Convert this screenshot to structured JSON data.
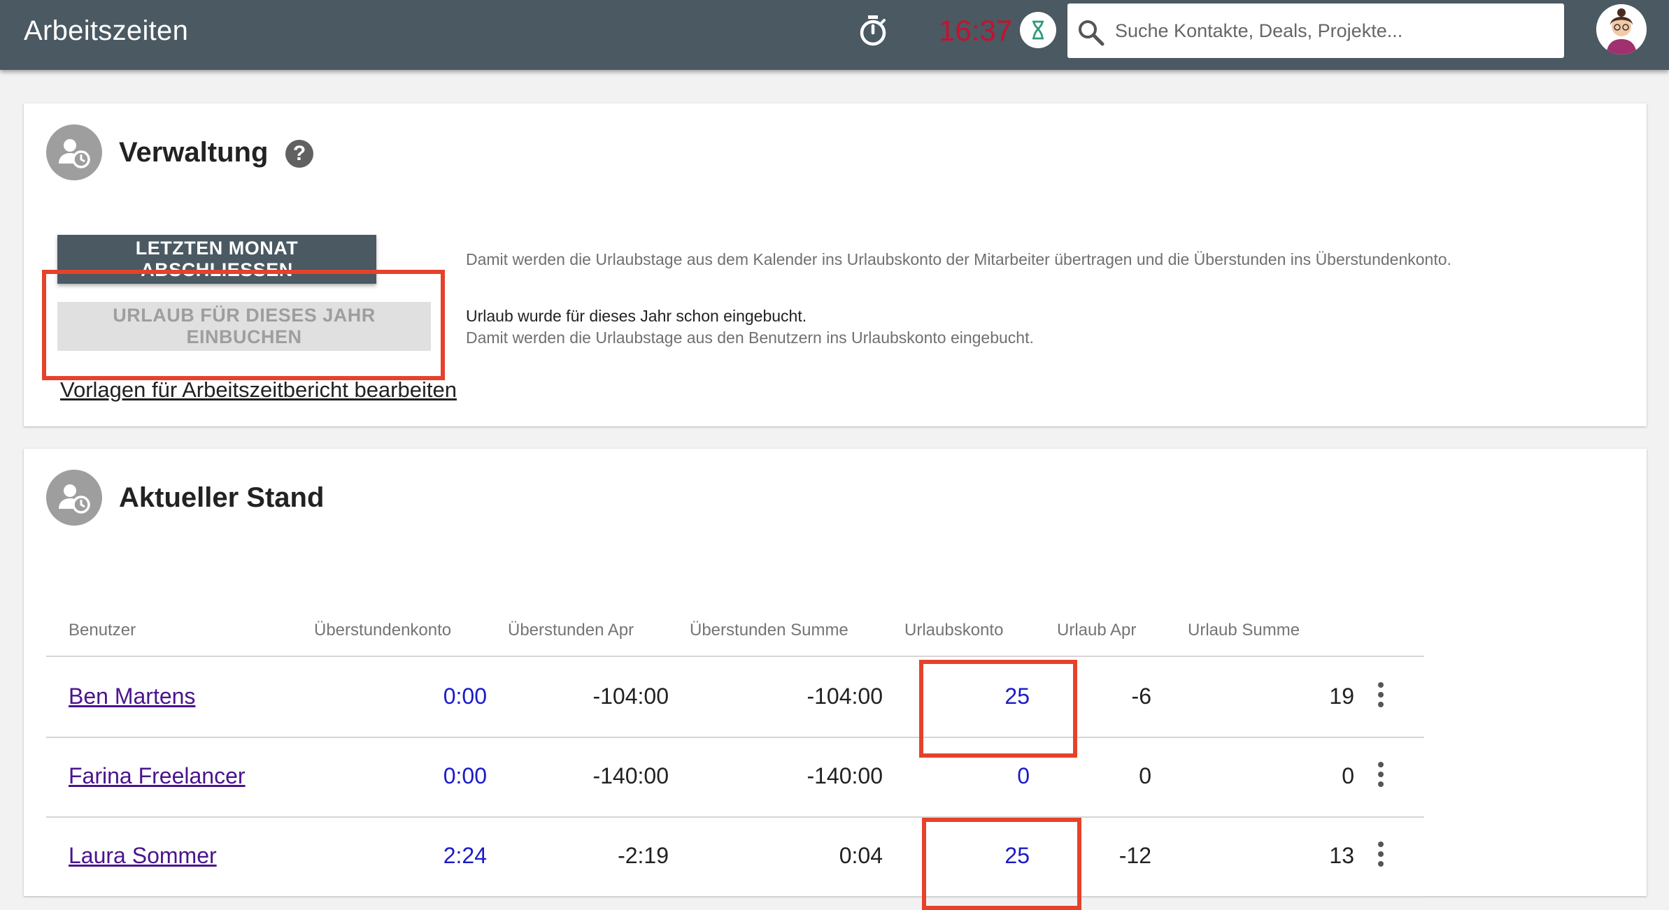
{
  "header": {
    "title": "Arbeitszeiten",
    "clock": "16:37",
    "search_placeholder": "Suche Kontakte, Deals, Projekte..."
  },
  "admin": {
    "title": "Verwaltung",
    "close_month_label": "LETZTEN MONAT ABSCHLIESSEN",
    "close_month_desc": "Damit werden die Urlaubstage aus dem Kalender ins Urlaubskonto der Mitarbeiter übertragen und die Überstunden ins Überstundenkonto.",
    "book_leave_label": "URLAUB FÜR DIESES JAHR EINBUCHEN",
    "book_leave_status": "Urlaub wurde für dieses Jahr schon eingebucht.",
    "book_leave_desc": "Damit werden die Urlaubstage aus den Benutzern ins Urlaubskonto eingebucht.",
    "template_link": "Vorlagen für Arbeitszeitbericht bearbeiten"
  },
  "status": {
    "title": "Aktueller Stand",
    "columns": [
      "Benutzer",
      "Überstundenkonto",
      "Überstunden Apr",
      "Überstunden Summe",
      "Urlaubskonto",
      "Urlaub Apr",
      "Urlaub Summe"
    ],
    "rows": [
      {
        "user": "Ben Martens",
        "overtime_account": "0:00",
        "overtime_month": "-104:00",
        "overtime_sum": "-104:00",
        "leave_account": "25",
        "leave_month": "-6",
        "leave_sum": "19"
      },
      {
        "user": "Farina Freelancer",
        "overtime_account": "0:00",
        "overtime_month": "-140:00",
        "overtime_sum": "-140:00",
        "leave_account": "0",
        "leave_month": "0",
        "leave_sum": "0"
      },
      {
        "user": "Laura Sommer",
        "overtime_account": "2:24",
        "overtime_month": "-2:19",
        "overtime_sum": "0:04",
        "leave_account": "25",
        "leave_month": "-12",
        "leave_sum": "13"
      }
    ]
  },
  "colors": {
    "topbar": "#4a5962",
    "clock": "#c4122f",
    "highlight": "#e5422b",
    "link_user": "#4a148c",
    "value_blue": "#1a1ac8"
  },
  "icons": [
    "stopwatch-icon",
    "hourglass-icon",
    "search-icon",
    "avatar",
    "user-clock-icon",
    "help-icon",
    "more-vert-icon"
  ]
}
